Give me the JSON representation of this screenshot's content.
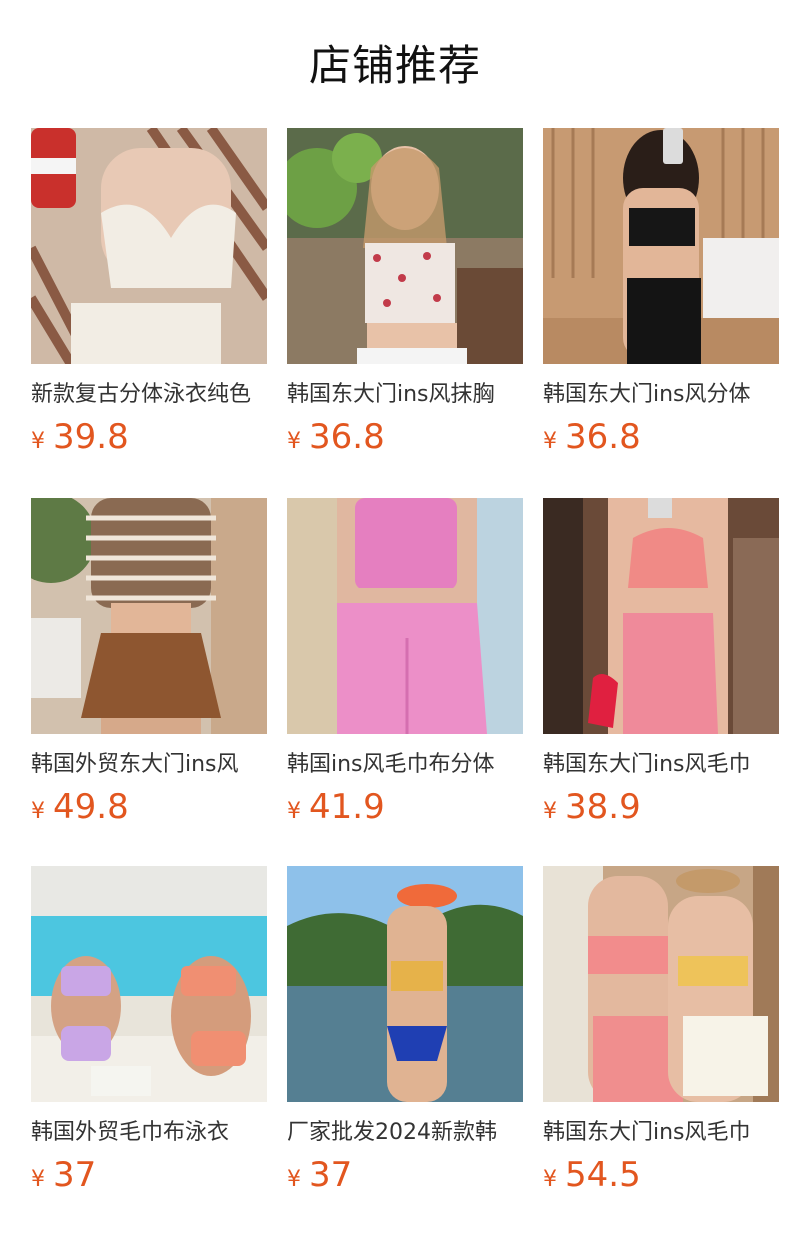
{
  "header": {
    "title": "店铺推荐"
  },
  "products": [
    {
      "name": "新款复古分体泳衣纯色",
      "currency": "¥",
      "price": "39.8",
      "image": "product-photo"
    },
    {
      "name": "韩国东大门ins风抹胸",
      "currency": "¥",
      "price": "36.8",
      "image": "product-photo"
    },
    {
      "name": "韩国东大门ins风分体",
      "currency": "¥",
      "price": "36.8",
      "image": "product-photo"
    },
    {
      "name": "韩国外贸东大门ins风",
      "currency": "¥",
      "price": "49.8",
      "image": "product-photo"
    },
    {
      "name": "韩国ins风毛巾布分体",
      "currency": "¥",
      "price": "41.9",
      "image": "product-photo"
    },
    {
      "name": "韩国东大门ins风毛巾",
      "currency": "¥",
      "price": "38.9",
      "image": "product-photo"
    },
    {
      "name": "韩国外贸毛巾布泳衣",
      "currency": "¥",
      "price": "37",
      "image": "product-photo"
    },
    {
      "name": "厂家批发2024新款韩",
      "currency": "¥",
      "price": "37",
      "image": "product-photo"
    },
    {
      "name": "韩国东大门ins风毛巾",
      "currency": "¥",
      "price": "54.5",
      "image": "product-photo"
    }
  ],
  "colors": {
    "price": "#e2561f",
    "title": "#111111",
    "name": "#333333"
  }
}
